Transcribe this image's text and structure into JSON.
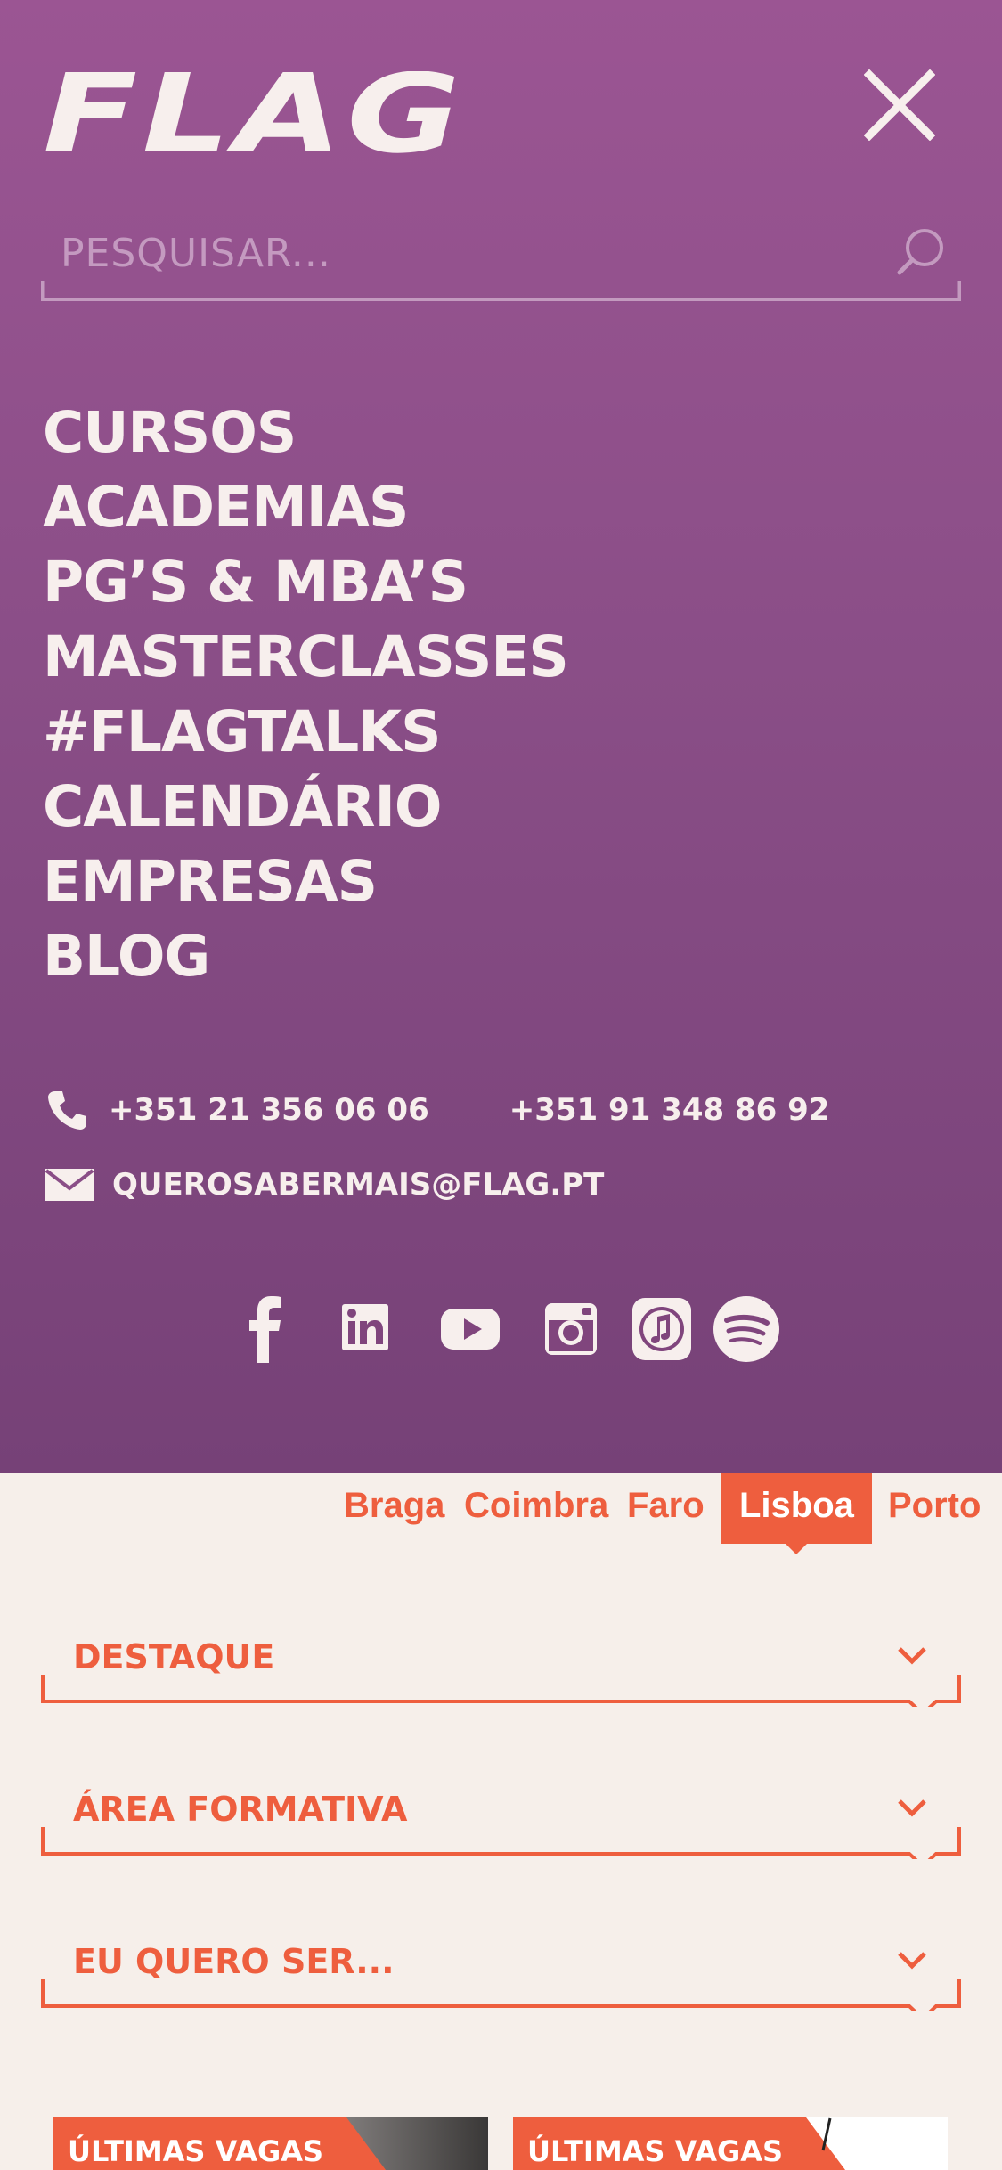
{
  "brand": {
    "logo_text": "FLAG"
  },
  "search": {
    "placeholder": "PESQUISAR..."
  },
  "nav": {
    "items": [
      "CURSOS",
      "ACADEMIAS",
      "PG’S & MBA’S",
      "MASTERCLASSES",
      "#FLAGTALKS",
      "CALENDÁRIO",
      "EMPRESAS",
      "BLOG"
    ]
  },
  "contact": {
    "phone1": "+351 21 356 06 06",
    "phone2": "+351 91 348 86 92",
    "email": "QUEROSABERMAIS@FLAG.PT"
  },
  "social": {
    "icons": [
      "facebook-icon",
      "linkedin-icon",
      "youtube-icon",
      "instagram-icon",
      "itunes-icon",
      "spotify-icon"
    ]
  },
  "cities": {
    "items": [
      "Braga",
      "Coimbra",
      "Faro",
      "Lisboa",
      "Porto"
    ],
    "active": "Lisboa"
  },
  "filters": {
    "destaque": "DESTAQUE",
    "area": "ÁREA FORMATIVA",
    "quero_ser": "EU QUERO SER..."
  },
  "cards": {
    "tag1": "ÚLTIMAS VAGAS",
    "tag2": "ÚLTIMAS VAGAS"
  },
  "colors": {
    "menu_top": "#9b5593",
    "menu_bottom": "#764177",
    "accent": "#ee5e3e",
    "background": "#f6efea",
    "text_light": "#f7efed"
  }
}
